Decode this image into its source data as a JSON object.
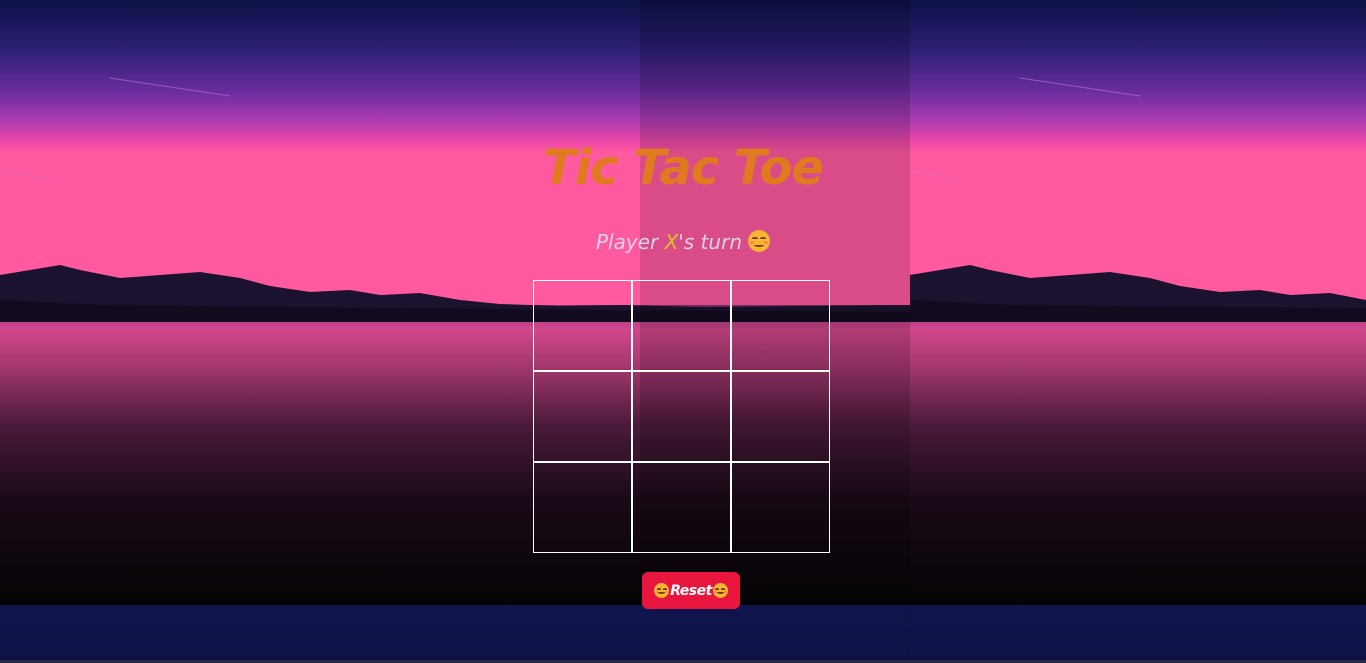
{
  "game": {
    "title": "Tic Tac Toe",
    "status": {
      "prefix": "Player ",
      "current_player": "X",
      "suffix": "'s turn",
      "emoji": "smiling-face-icon"
    },
    "board": {
      "cells": [
        "",
        "",
        "",
        "",
        "",
        "",
        "",
        "",
        ""
      ]
    },
    "reset_label": "Reset",
    "reset_emoji": "smiling-face-icon"
  },
  "colors": {
    "title": "#e07a1e",
    "status_text": "#d7d3ea",
    "player_mark": "#d8c028",
    "grid_lines": "#ffffff",
    "reset_button": "#e8163f"
  }
}
